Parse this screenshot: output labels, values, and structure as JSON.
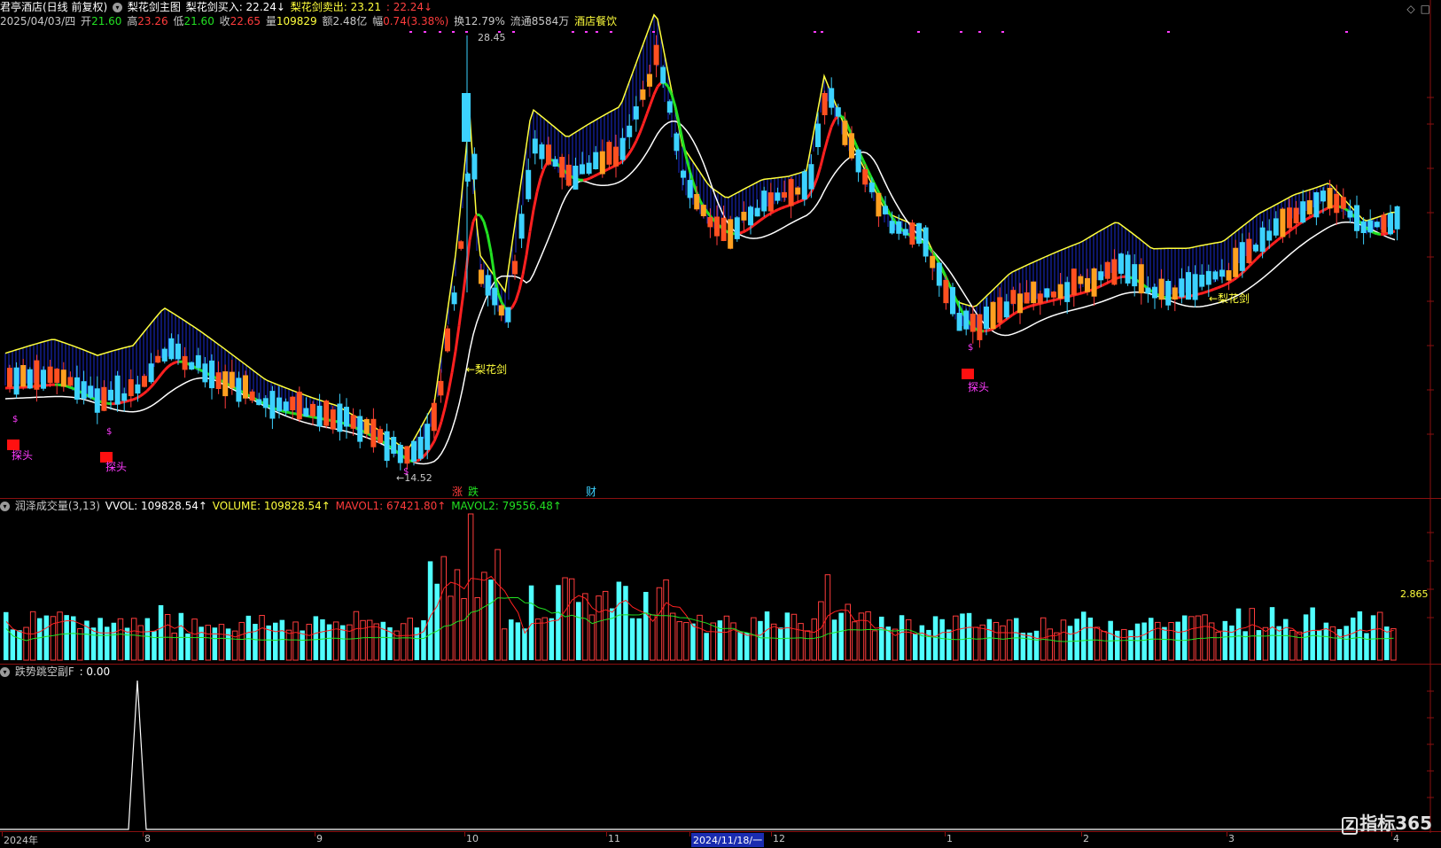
{
  "header": {
    "stock": "君亭酒店(日线 前复权)",
    "indicator": "梨花剑主图",
    "buy_label": "梨花剑买入: 22.24↓",
    "sell_label": "梨花剑卖出: 23.21",
    "sell_value2": ": 22.24↓",
    "date": "2025/04/03/四",
    "open_label": "开",
    "open": "21.60",
    "high_label": "高",
    "high": "23.26",
    "low_label": "低",
    "low": "21.60",
    "close_label": "收",
    "close": "22.65",
    "vol_label": "量",
    "vol": "109829",
    "amount_label": "额",
    "amount": "2.48亿",
    "change_label": "幅",
    "change": "0.74(3.38%)",
    "turnover_label": "换",
    "turnover": "12.79%",
    "float_label": "流通",
    "float": "8584万",
    "sector": "酒店餐饮"
  },
  "main_annotations": {
    "high_price": "28.45",
    "low_price": "←14.52",
    "lihuajian_1": "←梨花剑",
    "lihuajian_2": "←梨花剑",
    "tantou_1": "探头",
    "tantou_2": "探头",
    "tantou_3": "探头",
    "dollar": "$",
    "zhang": "涨",
    "die": "跌",
    "cai": "财"
  },
  "volume_panel": {
    "title": "润泽成交量(3,13)",
    "vvol": "VVOL: 109828.54↑",
    "volume": "VOLUME: 109828.54↑",
    "mavol1": "MAVOL1: 67421.80↑",
    "mavol2": "MAVOL2: 79556.48↑",
    "right_value": "2.865"
  },
  "sub_panel": {
    "title": "跌势跳空副F",
    "value": ": 0.00"
  },
  "time_axis": {
    "labels": [
      "2024年",
      "8",
      "9",
      "10",
      "11",
      "2024/11/18/一",
      "12",
      "1",
      "2",
      "3",
      "4"
    ]
  },
  "logo": "指标365",
  "colors": {
    "up": "#ff3c3c",
    "down": "#3cd2ff",
    "yellow": "#ffff3c",
    "green": "#22e022",
    "red_line": "#ff2020",
    "white_line": "#ffffff",
    "hatch": "#1a2cd0"
  }
}
